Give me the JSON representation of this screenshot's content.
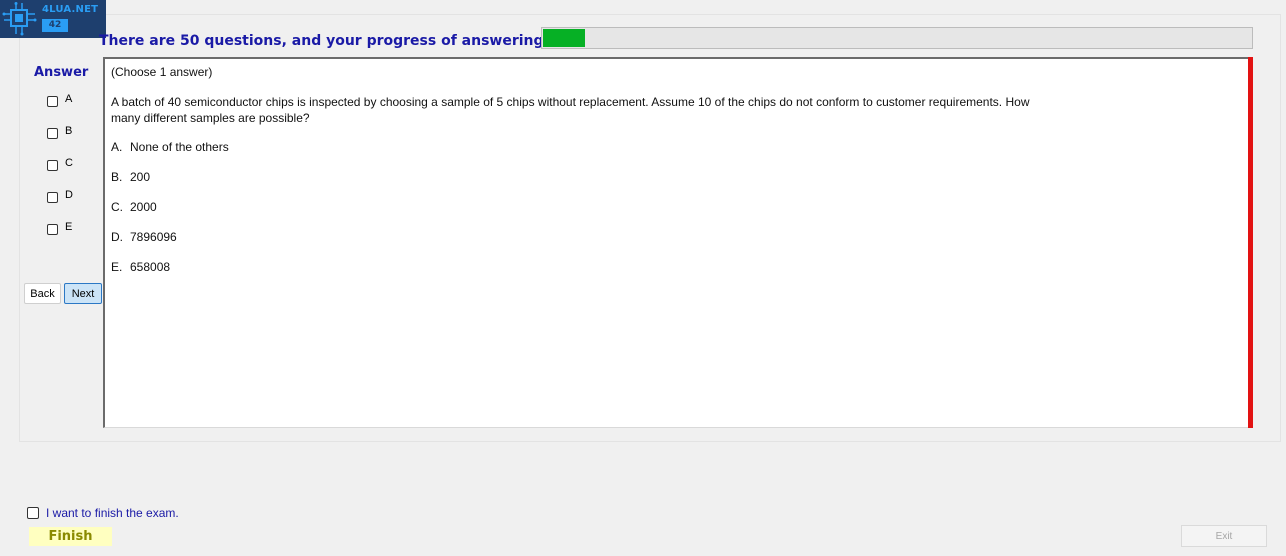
{
  "logo": {
    "title": "4LUA.NET",
    "subtitle": "42"
  },
  "header": {
    "progress_label": "There are 50 questions, and your progress of answering is",
    "progress_fraction": 0.06
  },
  "answer_panel": {
    "title": "Answer",
    "options": [
      {
        "letter": "A",
        "checked": false
      },
      {
        "letter": "B",
        "checked": false
      },
      {
        "letter": "C",
        "checked": false
      },
      {
        "letter": "D",
        "checked": false
      },
      {
        "letter": "E",
        "checked": false
      }
    ],
    "back_label": "Back",
    "next_label": "Next"
  },
  "question": {
    "instruction": "(Choose 1 answer)",
    "stem": "A batch of 40 semiconductor chips is inspected by choosing a sample of 5 chips without replacement. Assume 10 of the chips do not conform to customer requirements. How many different samples are possible?",
    "choices": [
      {
        "letter": "A.",
        "text": "None of the others"
      },
      {
        "letter": "B.",
        "text": "200"
      },
      {
        "letter": "C.",
        "text": "2000"
      },
      {
        "letter": "D.",
        "text": "7896096"
      },
      {
        "letter": "E.",
        "text": "658008"
      }
    ]
  },
  "footer": {
    "finish_confirm_label": "I want to finish the exam.",
    "finish_label": "Finish",
    "exit_label": "Exit"
  },
  "colors": {
    "accent_text": "#1a1aa6",
    "progress_fill": "#06b025",
    "scroll_marker": "#e21212",
    "finish_bg": "#ffffc0"
  }
}
